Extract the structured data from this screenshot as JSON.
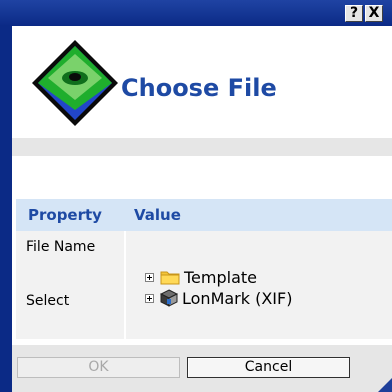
{
  "titlebar": {
    "help_label": "?",
    "close_label": "X"
  },
  "header": {
    "title": "Choose File"
  },
  "table": {
    "headers": {
      "property": "Property",
      "value": "Value"
    },
    "rows": [
      {
        "key": "File Name",
        "value": ""
      },
      {
        "key": "Select",
        "tree": [
          "Template",
          "LonMark (XIF)"
        ]
      }
    ]
  },
  "buttons": {
    "ok_label": "OK",
    "cancel_label": "Cancel"
  },
  "colors": {
    "titlebar": "#0b2a86",
    "accent_text": "#1e4aa4",
    "table_header_bg": "#d5e5f6",
    "band_grey": "#e6e6e6"
  },
  "icons": {
    "logo": "green-diamond-logo-icon",
    "folder": "folder-icon",
    "package": "package-box-icon"
  }
}
